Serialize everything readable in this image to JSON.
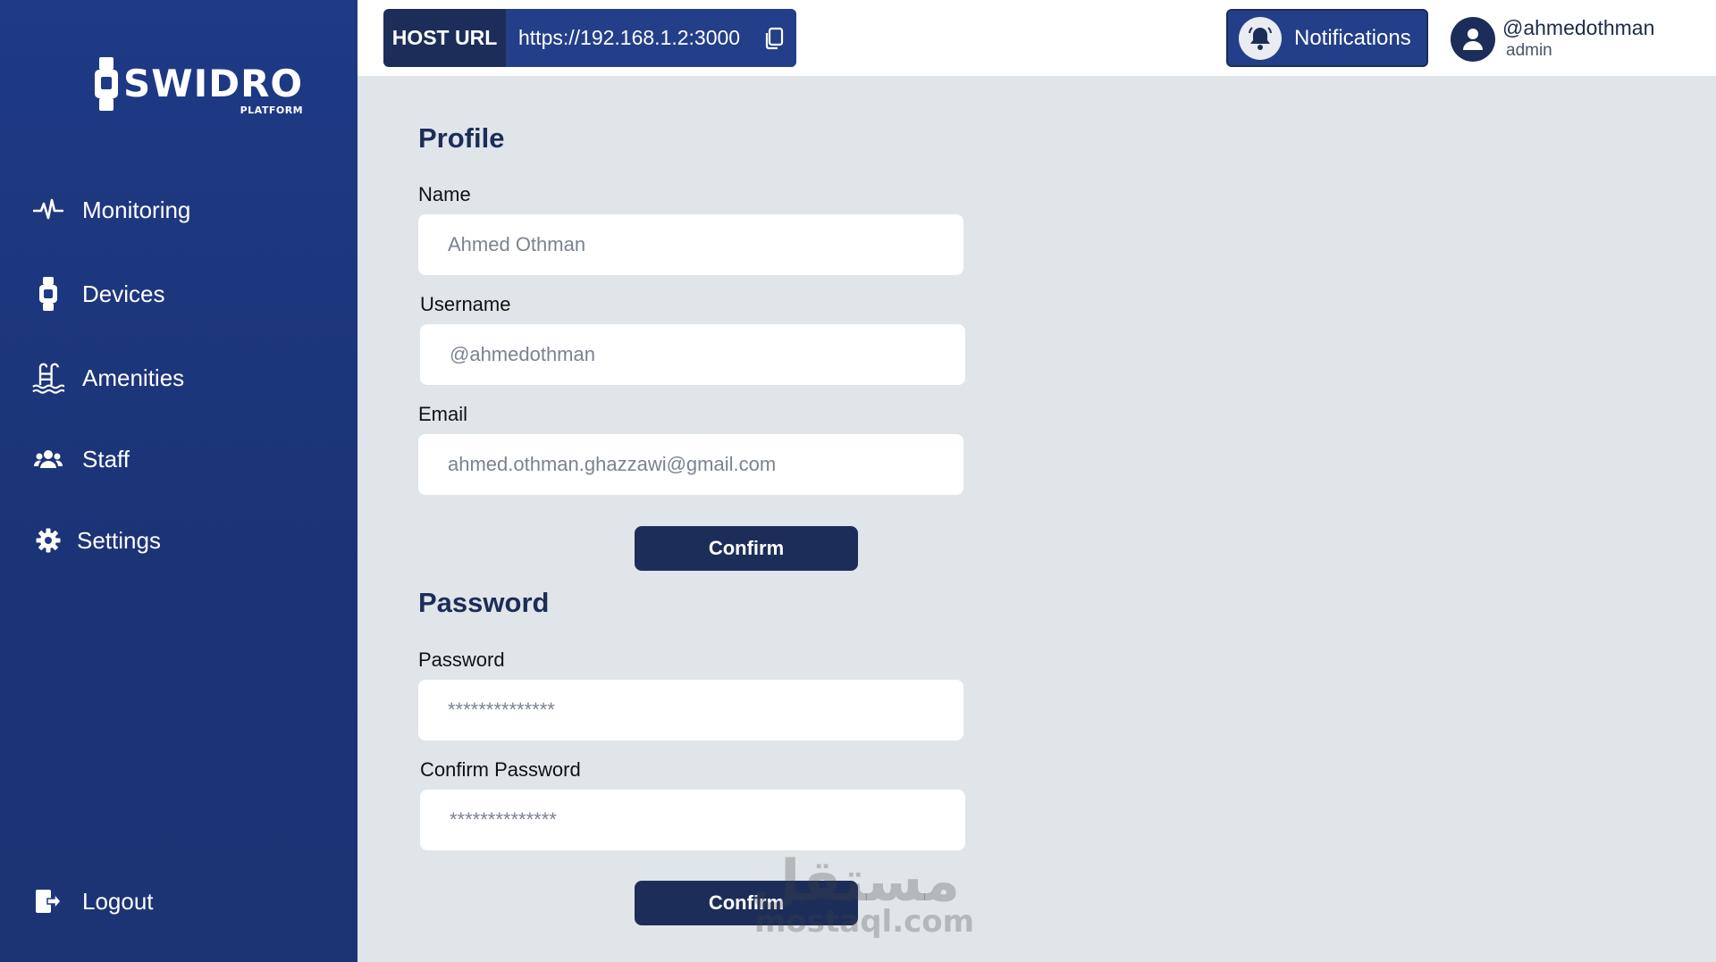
{
  "brand": {
    "name": "SWIDRO",
    "sub": "PLATFORM"
  },
  "sidebar": {
    "items": [
      {
        "label": "Monitoring",
        "icon": "heartbeat-icon"
      },
      {
        "label": "Devices",
        "icon": "watch-icon"
      },
      {
        "label": "Amenities",
        "icon": "pool-icon"
      },
      {
        "label": "Staff",
        "icon": "users-icon"
      },
      {
        "label": "Settings",
        "icon": "gear-icon"
      }
    ],
    "logout": {
      "label": "Logout",
      "icon": "logout-icon"
    }
  },
  "topbar": {
    "host_label": "HOST URL",
    "host_url": "https://192.168.1.2:3000",
    "notifications_label": "Notifications",
    "user_name": "@ahmedothman",
    "user_role": "admin"
  },
  "profile": {
    "title": "Profile",
    "name_label": "Name",
    "name_placeholder": "Ahmed Othman",
    "username_label": "Username",
    "username_placeholder": "@ahmedothman",
    "email_label": "Email",
    "email_placeholder": "ahmed.othman.ghazzawi@gmail.com",
    "confirm_label": "Confirm"
  },
  "password": {
    "title": "Password",
    "password_label": "Password",
    "password_placeholder": "**************",
    "confirm_password_label": "Confirm Password",
    "confirm_password_placeholder": "**************",
    "confirm_label": "Confirm"
  },
  "watermark": {
    "arabic": "مستقل",
    "latin": "mostaql.com"
  },
  "colors": {
    "sidebar": "#1f3a86",
    "primary": "#1c2d59",
    "accent": "#233f8a",
    "background": "#e0e5e9"
  }
}
